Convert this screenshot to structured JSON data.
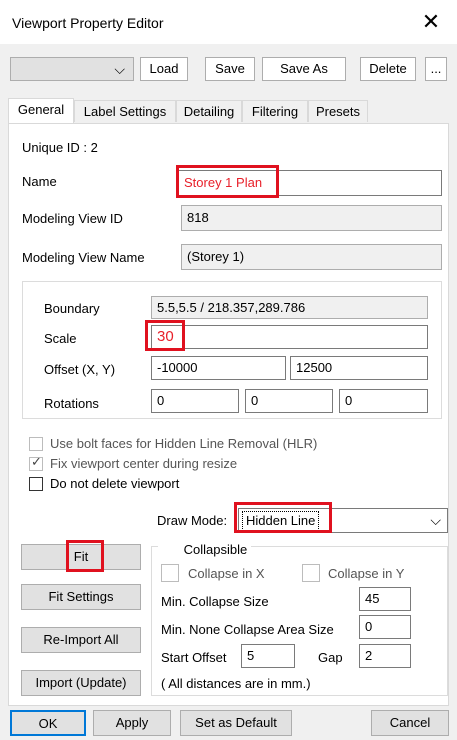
{
  "window": {
    "title": "Viewport Property Editor",
    "close_glyph": "✕"
  },
  "toolbar": {
    "combo_arrow": "⌵",
    "load": "Load",
    "save": "Save",
    "save_as": "Save As",
    "delete": "Delete",
    "more": "..."
  },
  "tabs": [
    "General",
    "Label Settings",
    "Detailing",
    "Filtering",
    "Presets"
  ],
  "general": {
    "unique_id": "Unique ID : 2",
    "name_label": "Name",
    "name_value": "Storey 1 Plan",
    "modeling_view_id_label": "Modeling View ID",
    "modeling_view_id_value": "818",
    "modeling_view_name_label": "Modeling View Name",
    "modeling_view_name_value": "(Storey 1)"
  },
  "geometry": {
    "boundary_label": "Boundary",
    "boundary_value": "5.5,5.5 / 218.357,289.786",
    "scale_label": "Scale",
    "scale_value": "30",
    "offset_label": "Offset (X, Y)",
    "offset_x": "-10000",
    "offset_y": "12500",
    "rotations_label": "Rotations",
    "rot_1": "0",
    "rot_2": "0",
    "rot_3": "0"
  },
  "options": {
    "hlr": "Use bolt faces for Hidden Line Removal (HLR)",
    "fix_center": "Fix viewport center during resize",
    "no_delete": "Do not delete viewport",
    "checked_mark": "✓"
  },
  "draw_mode": {
    "label": "Draw Mode:",
    "value": "Hidden Line",
    "arrow": "⌵"
  },
  "side_buttons": {
    "fit": "Fit",
    "fit_settings": "Fit Settings",
    "reimport_all": "Re-Import All",
    "import_update": "Import (Update)"
  },
  "collapse": {
    "collapsible": "Collapsible",
    "collapse_x": "Collapse in X",
    "collapse_y": "Collapse in Y",
    "min_collapse_size_label": "Min. Collapse Size",
    "min_collapse_size_value": "45",
    "min_none_label": "Min. None Collapse Area Size",
    "min_none_value": "0",
    "start_offset_label": "Start Offset",
    "start_offset_value": "5",
    "gap_label": "Gap",
    "gap_value": "2",
    "note": "( All distances are in mm.)"
  },
  "footer": {
    "ok": "OK",
    "apply": "Apply",
    "set_default": "Set as Default",
    "cancel": "Cancel"
  },
  "colors": {
    "highlight": "#e0111f",
    "red_text": "#e8202a",
    "focus_blue": "#0078d7"
  }
}
